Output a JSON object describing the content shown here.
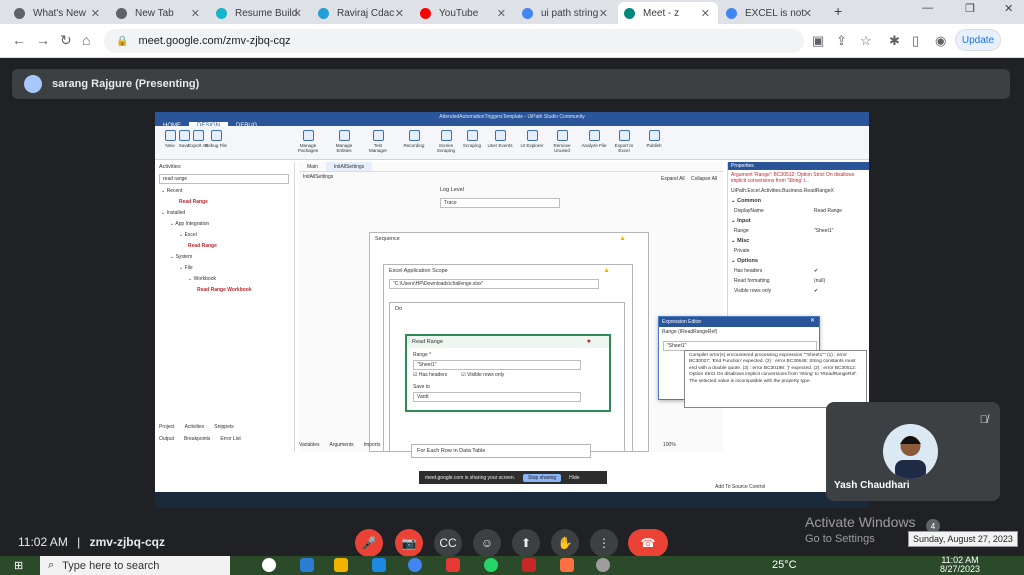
{
  "browser": {
    "tabs": [
      {
        "label": "What's New",
        "favicon_color": "#5f6368"
      },
      {
        "label": "New Tab",
        "favicon_color": "#5f6368"
      },
      {
        "label": "Resume Build",
        "favicon_color": "#12b5cb"
      },
      {
        "label": "Raviraj Cdac",
        "favicon_color": "#229ed9"
      },
      {
        "label": "YouTube",
        "favicon_color": "#ff0000"
      },
      {
        "label": "ui path string",
        "favicon_color": "#4285f4"
      },
      {
        "label": "Meet - z",
        "favicon_color": "#00897b",
        "active": true
      },
      {
        "label": "EXCEL is not",
        "favicon_color": "#4285f4"
      }
    ],
    "new_tab": "+",
    "url": "meet.google.com/zmv-zjbq-cqz",
    "update_label": "Update"
  },
  "meet": {
    "presenter_label": "sarang Rajgure (Presenting)",
    "time": "11:02 AM",
    "separator": "|",
    "meeting_code": "zmv-zjbq-cqz",
    "participant_name": "Yash Chaudhari",
    "participant_count": "4",
    "controls": {
      "mic": "🎤",
      "camera": "📷",
      "captions": "CC",
      "emoji": "☺",
      "present": "⬆",
      "hand": "✋",
      "more": "⋮",
      "end": "☎"
    },
    "activate_title": "Activate Windows",
    "activate_sub": "Go to Settings",
    "date_tooltip": "Sunday, August 27, 2023"
  },
  "uipath": {
    "title": "AttendedAutomationTriggersTemplate - UiPath Studio Community",
    "menu_tabs": [
      "HOME",
      "DESIGN",
      "DEBUG"
    ],
    "ribbon": [
      "New",
      "Save",
      "Export As",
      "Debug File",
      "Manage Packages",
      "Manage Entities",
      "Test Manager",
      "Recording",
      "Screen Scraping",
      "Scraping",
      "User Events",
      "UI Explorer",
      "Remove Unused",
      "Analyze File",
      "Export to Excel",
      "Publish"
    ],
    "activities_title": "Activities",
    "search_value": "read range",
    "tree": [
      {
        "label": "Recent",
        "indent": 0
      },
      {
        "label": "Read Range",
        "indent": 2,
        "hl": true
      },
      {
        "label": "Installed",
        "indent": 0
      },
      {
        "label": "App Integration",
        "indent": 1
      },
      {
        "label": "Excel",
        "indent": 2
      },
      {
        "label": "Read Range",
        "indent": 3,
        "hl": true
      },
      {
        "label": "System",
        "indent": 1
      },
      {
        "label": "File",
        "indent": 2
      },
      {
        "label": "Workbook",
        "indent": 3
      },
      {
        "label": "Read Range Workbook",
        "indent": 4,
        "hl": true
      }
    ],
    "canvas_tabs": [
      "Main",
      "InitAllSettings"
    ],
    "breadcrumb": "InitAllSettings",
    "expand_all": "Expand All",
    "collapse_all": "Collapse All",
    "log_level_label": "Log Level",
    "log_level_value": "Trace",
    "sequence_label": "Sequence",
    "excel_scope_label": "Excel Application Scope",
    "excel_path": "\"C:\\Users\\HP\\Downloads\\challenge.xlsx\"",
    "do_label": "Do",
    "read_range_label": "Read Range",
    "range_label": "Range *",
    "range_value": "\"Sheet1\"",
    "has_headers": "Has headers",
    "visible_rows": "Visible rows only",
    "save_to_label": "Save to",
    "save_to_value": "Vardt",
    "foreach_label": "For Each Row in Data Table",
    "bottom_tabs": [
      "Variables",
      "Arguments",
      "Imports"
    ],
    "left_bottom_tabs": [
      "Project",
      "Activities",
      "Snippets"
    ],
    "left_bottom_tabs2": [
      "Output",
      "Breakpoints",
      "Error List"
    ],
    "zoom": "100%",
    "properties_title": "Properties",
    "properties_error": "Argument 'Range': BC30512: Option Strict On disallows implicit conversions from 'String' t...",
    "properties_class": "UiPath.Excel.Activities.Business.ReadRangeX",
    "prop_sections": [
      {
        "name": "Common",
        "rows": [
          {
            "k": "DisplayName",
            "v": "Read Range"
          }
        ]
      },
      {
        "name": "Input",
        "rows": [
          {
            "k": "Range",
            "v": "\"Sheet1\""
          }
        ]
      },
      {
        "name": "Misc",
        "rows": [
          {
            "k": "Private",
            "v": ""
          }
        ]
      },
      {
        "name": "Options",
        "rows": [
          {
            "k": "Has headers",
            "v": "✔"
          },
          {
            "k": "Read formatting",
            "v": "(null)"
          },
          {
            "k": "Visible rows only",
            "v": "✔"
          }
        ]
      }
    ],
    "expr_title": "Expression Editor",
    "expr_label": "Range (IReadRangeRef)",
    "expr_value": "\"Sheet1\"",
    "error_tooltip": "Compiler error(s) encountered processing expression \"\"Sheet1\"\" (1) : error BC30027: 'End Function' expected. (2) : error BC30648: String constants must end with a double quote. (3) : error BC30198: ')' expected. (2) : error BC30512: Option Strict On disallows implicit conversions from 'String' to 'IReadRangeRef'. The selected value is incompatible with the property type.",
    "sharing_text": "meet.google.com is sharing your screen.",
    "stop_sharing": "Stop sharing",
    "hide": "Hide",
    "add_source": "Add To Source Control"
  },
  "taskbar": {
    "search_placeholder": "Type here to search",
    "weather": "25°C",
    "clock_time": "11:02 AM",
    "clock_date": "8/27/2023"
  }
}
